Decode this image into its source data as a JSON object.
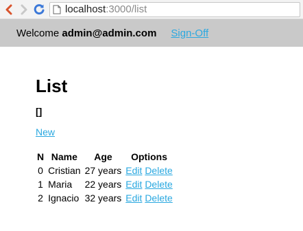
{
  "browser": {
    "url_host": "localhost",
    "url_path": ":3000/list"
  },
  "header": {
    "welcome_label": "Welcome ",
    "user_email": "admin@admin.com",
    "signoff_label": "Sign-Off"
  },
  "main": {
    "title": "List",
    "raw_output": "[]",
    "new_label": "New",
    "table": {
      "headers": [
        "N",
        "Name",
        "Age",
        "Options"
      ],
      "rows": [
        {
          "n": "0",
          "name": "Cristian",
          "age": "27 years",
          "edit": "Edit",
          "delete": "Delete"
        },
        {
          "n": "1",
          "name": "Maria",
          "age": "22 years",
          "edit": "Edit",
          "delete": "Delete"
        },
        {
          "n": "2",
          "name": "Ignacio",
          "age": "32 years",
          "edit": "Edit",
          "delete": "Delete"
        }
      ]
    }
  },
  "colors": {
    "link": "#2aa8e0",
    "topbar_bg": "#c9c9c9",
    "back_arrow": "#d9532c",
    "reload": "#3b78d8"
  }
}
